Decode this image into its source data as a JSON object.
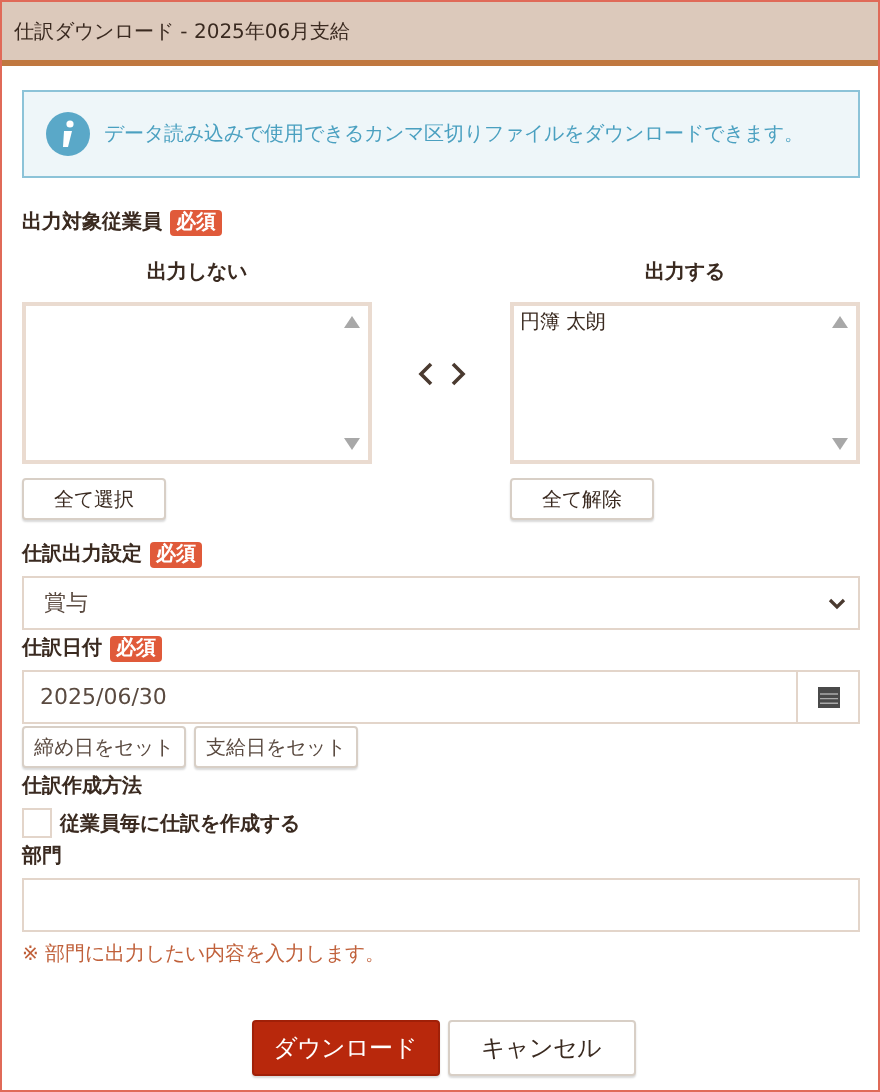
{
  "window": {
    "title": "仕訳ダウンロード - 2025年06月支給"
  },
  "info": {
    "message": "データ読み込みで使用できるカンマ区切りファイルをダウンロードできます。"
  },
  "employees": {
    "label": "出力対象従業員",
    "badge": "必須",
    "excluded": {
      "heading": "出力しない",
      "button": "全て選択"
    },
    "included": {
      "heading": "出力する",
      "items": [
        {
          "name": "円簿 太朗",
          "selected": false
        }
      ],
      "button": "全て解除"
    }
  },
  "journal_setting": {
    "label": "仕訳出力設定",
    "badge": "必須",
    "value": "賞与"
  },
  "journal_date": {
    "label": "仕訳日付",
    "badge": "必須",
    "value": "2025/06/30",
    "buttons": [
      "締め日をセット",
      "支給日をセット"
    ]
  },
  "method": {
    "label": "仕訳作成方法",
    "checkbox": {
      "label": "従業員毎に仕訳を作成する",
      "checked": false
    }
  },
  "department": {
    "label": "部門",
    "note": "※ 部門に出力したい内容を入力します。"
  },
  "actions": [
    {
      "label": "ダウンロード",
      "kind": "primary"
    },
    {
      "label": "キャンセル",
      "kind": "secondary"
    }
  ]
}
